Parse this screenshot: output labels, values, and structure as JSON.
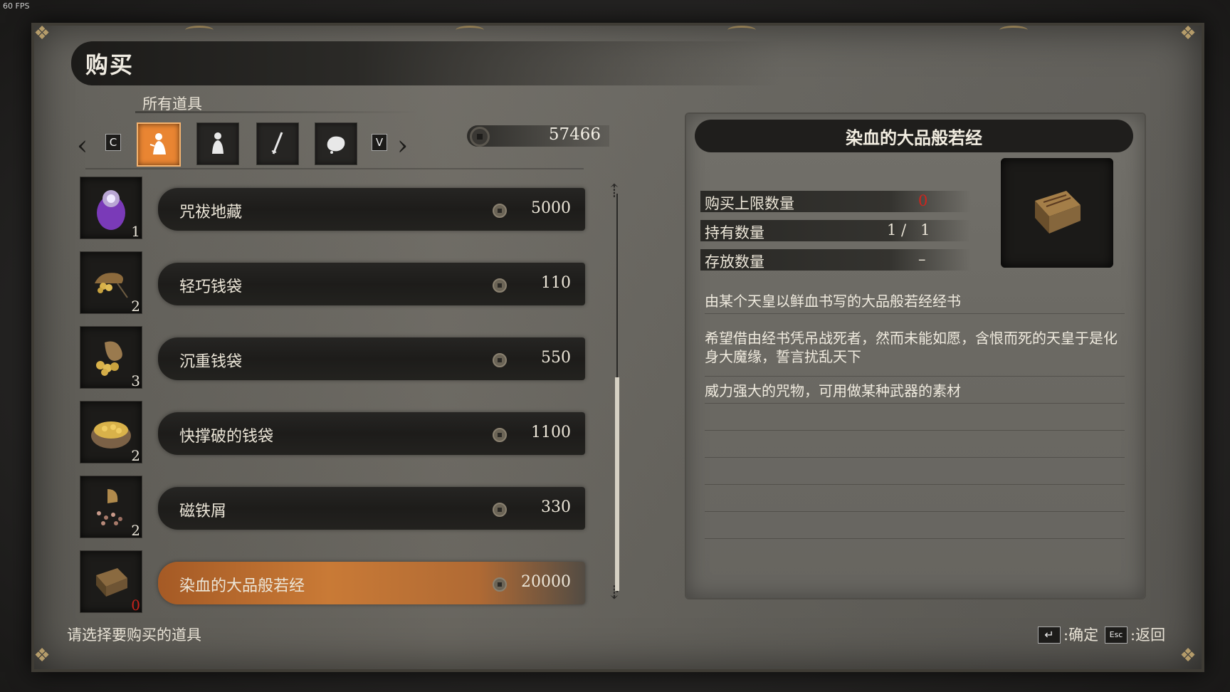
{
  "overlay": {
    "fps": "60 FPS"
  },
  "header": {
    "title": "购买",
    "category": "所有道具"
  },
  "tabs": {
    "prev_key": "C",
    "next_key": "V",
    "items": [
      {
        "icon": "kneeling-figure-icon",
        "active": true
      },
      {
        "icon": "figure-icon",
        "active": false
      },
      {
        "icon": "blade-icon",
        "active": false
      },
      {
        "icon": "pouch-icon",
        "active": false
      }
    ]
  },
  "money": {
    "amount": "57466"
  },
  "items": [
    {
      "name": "咒祓地藏",
      "price": "5000",
      "qty": "1",
      "icon": "jizo-statue-icon"
    },
    {
      "name": "轻巧钱袋",
      "price": "110",
      "qty": "2",
      "icon": "light-coin-purse-icon"
    },
    {
      "name": "沉重钱袋",
      "price": "550",
      "qty": "3",
      "icon": "heavy-coin-purse-icon"
    },
    {
      "name": "快撑破的钱袋",
      "price": "1100",
      "qty": "2",
      "icon": "bulging-coin-purse-icon"
    },
    {
      "name": "磁铁屑",
      "price": "330",
      "qty": "2",
      "icon": "lodestone-shard-icon"
    },
    {
      "name": "染血的大品般若经",
      "price": "20000",
      "qty": "0",
      "icon": "sutra-book-icon",
      "selected": true
    }
  ],
  "detail": {
    "title": "染血的大品般若经",
    "stats": [
      {
        "label": "购买上限数量",
        "value": "0",
        "highlight": "#d0241c"
      },
      {
        "label": "持有数量",
        "value": "1 /   1"
      },
      {
        "label": "存放数量",
        "value": "–"
      }
    ],
    "descriptions": [
      "由某个天皇以鲜血书写的大品般若经经书",
      "希望借由经书凭吊战死者，然而未能如愿，含恨而死的天皇于是化身大魔缘，誓言扰乱天下",
      "威力强大的咒物，可用做某种武器的素材"
    ]
  },
  "footer": {
    "hint": "请选择要购买的道具",
    "confirm_key": "↵",
    "confirm_label": ":确定",
    "back_key": "Esc",
    "back_label": ":返回"
  },
  "colors": {
    "accent": "#e98532",
    "warning": "#d0241c",
    "panel": "#6b6963"
  }
}
